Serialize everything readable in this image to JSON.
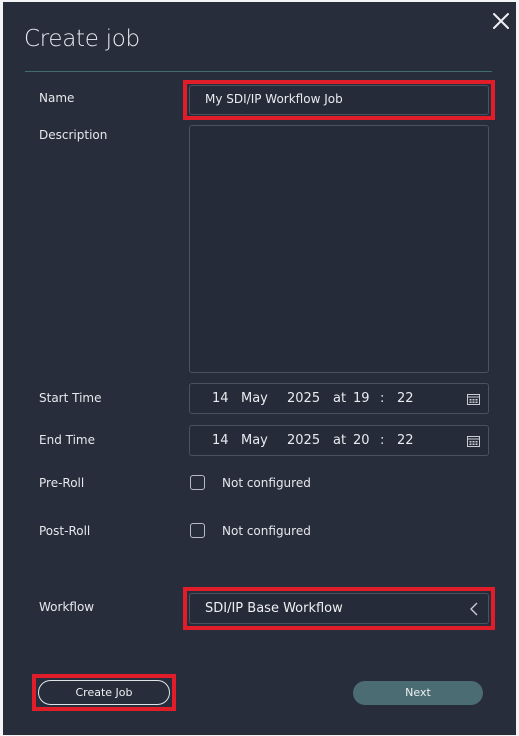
{
  "dialog": {
    "title": "Create job",
    "close_icon": "close-icon"
  },
  "form": {
    "name_label": "Name",
    "name_value": "My SDI/IP Workflow Job",
    "description_label": "Description",
    "description_value": "",
    "start_time": {
      "label": "Start Time",
      "day": "14",
      "month": "May",
      "year": "2025",
      "at": "at",
      "hour": "19",
      "sep": ":",
      "minute": "22",
      "icon": "calendar-icon"
    },
    "end_time": {
      "label": "End Time",
      "day": "14",
      "month": "May",
      "year": "2025",
      "at": "at",
      "hour": "20",
      "sep": ":",
      "minute": "22",
      "icon": "calendar-icon"
    },
    "pre_roll": {
      "label": "Pre-Roll",
      "checkbox_text": "Not configured",
      "checked": false
    },
    "post_roll": {
      "label": "Post-Roll",
      "checkbox_text": "Not configured",
      "checked": false
    },
    "workflow": {
      "label": "Workflow",
      "value": "SDI/IP Base Workflow",
      "icon": "chevron-left-icon"
    }
  },
  "footer": {
    "create_label": "Create Job",
    "next_label": "Next"
  },
  "colors": {
    "background": "#272d3b",
    "highlight": "#e11d2a",
    "next_button": "#4b6c73",
    "divider": "#3f6d6d"
  }
}
